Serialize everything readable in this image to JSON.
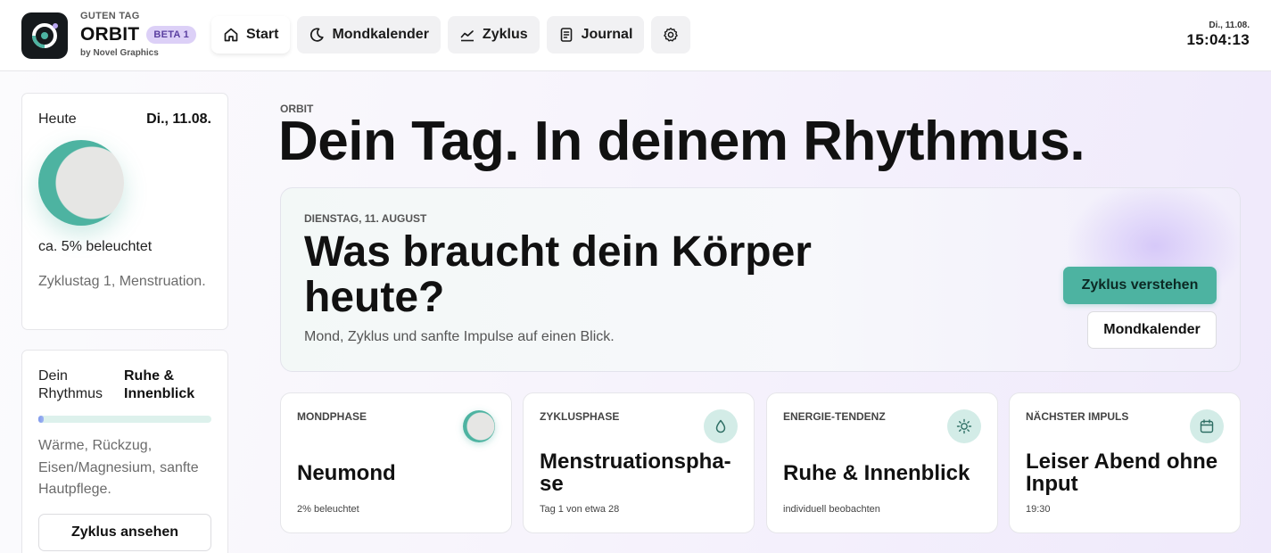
{
  "header": {
    "greeting": "GUTEN TAG",
    "app_name": "ORBIT",
    "badge": "BETA 1",
    "byline": "by Novel Graphics",
    "nav": [
      {
        "label": "Start",
        "icon": "home-icon",
        "active": true
      },
      {
        "label": "Mondkalender",
        "icon": "moon-icon"
      },
      {
        "label": "Zyklus",
        "icon": "chart-line-icon"
      },
      {
        "label": "Journal",
        "icon": "notebook-icon"
      },
      {
        "label": "",
        "icon": "settings-icon"
      }
    ],
    "clock": {
      "date": "Di., 11.08.",
      "time": "15:04:13"
    }
  },
  "sidebar": {
    "today": {
      "label": "Heute",
      "date": "Di., 11.08.",
      "illumination": "ca. 5% beleuchtet",
      "cycle_note": "Zyklustag 1, Menstruation."
    },
    "rhythm": {
      "label": "Dein Rhythmus",
      "value": "Ruhe & Innenblick",
      "progress": 0.03,
      "text": "Wärme, Rückzug, Eisen/Magnesium, sanfte Hautpflege.",
      "button": "Zyklus ansehen"
    }
  },
  "hero": {
    "eyebrow": "ORBIT",
    "title": "Dein Tag. In deinem Rhythmus.",
    "card": {
      "date": "DIENSTAG, 11. AUGUST",
      "question": "Was braucht dein Körper heute?",
      "subtitle": "Mond, Zyklus und sanfte Impulse auf einen Blick.",
      "primary_button": "Zyklus verstehen",
      "secondary_button": "Mondkalender"
    }
  },
  "stats": [
    {
      "label": "MONDPHASE",
      "value": "Neumond",
      "sub": "2% beleuchtet",
      "icon": "moon-phase-icon"
    },
    {
      "label": "ZYKLUSPHASE",
      "value": "Menstruationspha-se",
      "sub": "Tag 1 von etwa 28",
      "icon": "drop-icon"
    },
    {
      "label": "ENERGIE-TENDENZ",
      "value": "Ruhe & Innenblick",
      "sub": "individuell beobachten",
      "icon": "sun-icon"
    },
    {
      "label": "NÄCHSTER IMPULS",
      "value": "Leiser Abend ohne Input",
      "sub": "19:30",
      "icon": "calendar-icon"
    }
  ],
  "colors": {
    "accent": "#4db3a1",
    "beta_badge_bg": "#dcd0f7",
    "progress_fill": "#7f99ec",
    "icon_circle": "#d3ece7"
  }
}
